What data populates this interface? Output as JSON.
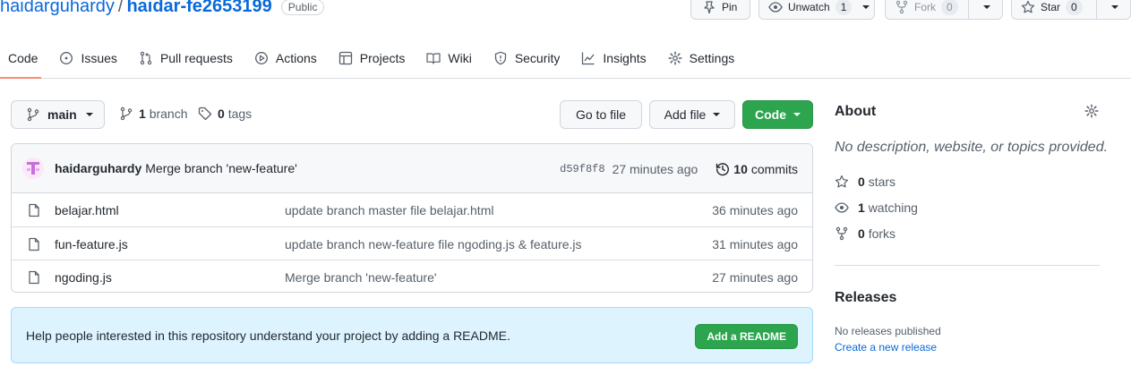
{
  "repo": {
    "owner": "haidarguhardy",
    "separator": "/",
    "name": "haidar-fe2653199",
    "visibility": "Public"
  },
  "header_actions": {
    "pin_label": "Pin",
    "unwatch_label": "Unwatch",
    "unwatch_count": "1",
    "fork_label": "Fork",
    "fork_count": "0",
    "star_label": "Star",
    "star_count": "0"
  },
  "tabs": [
    {
      "label": "Code",
      "icon": "code-icon"
    },
    {
      "label": "Issues",
      "icon": "issue-icon"
    },
    {
      "label": "Pull requests",
      "icon": "pull-request-icon"
    },
    {
      "label": "Actions",
      "icon": "play-icon"
    },
    {
      "label": "Projects",
      "icon": "table-icon"
    },
    {
      "label": "Wiki",
      "icon": "book-icon"
    },
    {
      "label": "Security",
      "icon": "shield-icon"
    },
    {
      "label": "Insights",
      "icon": "graph-icon"
    },
    {
      "label": "Settings",
      "icon": "gear-icon"
    }
  ],
  "branch_bar": {
    "branch_name": "main",
    "branch_count": "1",
    "branch_label": "branch",
    "tag_count": "0",
    "tag_label": "tags",
    "go_to_file": "Go to file",
    "add_file": "Add file",
    "code": "Code"
  },
  "latest_commit": {
    "author": "haidarguhardy",
    "message": "Merge branch 'new-feature'",
    "sha": "d59f8f8",
    "age": "27 minutes ago",
    "commit_count": "10",
    "commit_label": "commits"
  },
  "files": [
    {
      "name": "belajar.html",
      "message": "update branch master file belajar.html",
      "age": "36 minutes ago"
    },
    {
      "name": "fun-feature.js",
      "message": "update branch new-feature file ngoding.js & feature.js",
      "age": "31 minutes ago"
    },
    {
      "name": "ngoding.js",
      "message": "Merge branch 'new-feature'",
      "age": "27 minutes ago"
    }
  ],
  "readme_banner": {
    "text": "Help people interested in this repository understand your project by adding a README.",
    "button": "Add a README"
  },
  "about": {
    "title": "About",
    "description": "No description, website, or topics provided.",
    "stars_count": "0",
    "stars_label": "stars",
    "watching_count": "1",
    "watching_label": "watching",
    "forks_count": "0",
    "forks_label": "forks"
  },
  "releases": {
    "title": "Releases",
    "none_text": "No releases published",
    "create_link": "Create a new release"
  },
  "colors": {
    "accent_blue": "#0969da",
    "primary_green": "#2da44e",
    "tab_underline": "#fd8c73",
    "banner_bg": "#ddf4ff"
  }
}
